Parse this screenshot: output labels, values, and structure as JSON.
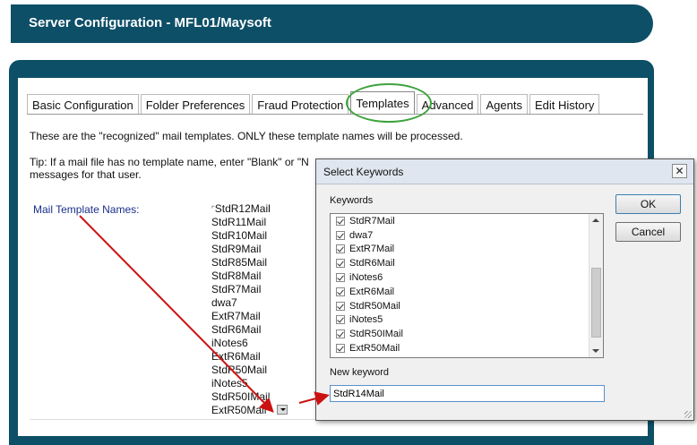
{
  "header": {
    "title": "Server Configuration - MFL01/Maysoft"
  },
  "tabs": [
    {
      "label": "Basic Configuration",
      "active": false
    },
    {
      "label": "Folder Preferences",
      "active": false
    },
    {
      "label": "Fraud Protection",
      "active": false
    },
    {
      "label": "Templates",
      "active": true
    },
    {
      "label": "Advanced",
      "active": false
    },
    {
      "label": "Agents",
      "active": false
    },
    {
      "label": "Edit History",
      "active": false
    }
  ],
  "content": {
    "intro": "These are the \"recognized\" mail templates. ONLY these template names will be processed.",
    "tip_line1": "Tip: If a mail file has no template name, enter \"Blank\" or \"N",
    "tip_line2": "messages for that user.",
    "field_label": "Mail Template Names:",
    "templates": [
      "StdR12Mail",
      "StdR11Mail",
      "StdR10Mail",
      "StdR9Mail",
      "StdR85Mail",
      "StdR8Mail",
      "StdR7Mail",
      "dwa7",
      "ExtR7Mail",
      "StdR6Mail",
      "iNotes6",
      "ExtR6Mail",
      "StdR50Mail",
      "iNotes5",
      "StdR50IMail",
      "ExtR50Mail"
    ]
  },
  "dialog": {
    "title": "Select Keywords",
    "close_label": "✕",
    "keywords_label": "Keywords",
    "keywords": [
      {
        "label": "StdR7Mail",
        "checked": true
      },
      {
        "label": "dwa7",
        "checked": true
      },
      {
        "label": "ExtR7Mail",
        "checked": true
      },
      {
        "label": "StdR6Mail",
        "checked": true
      },
      {
        "label": "iNotes6",
        "checked": true
      },
      {
        "label": "ExtR6Mail",
        "checked": true
      },
      {
        "label": "StdR50Mail",
        "checked": true
      },
      {
        "label": "iNotes5",
        "checked": true
      },
      {
        "label": "StdR50IMail",
        "checked": true
      },
      {
        "label": "ExtR50Mail",
        "checked": true
      }
    ],
    "new_keyword_label": "New keyword",
    "new_keyword_value": "StdR14Mail",
    "ok_label": "OK",
    "cancel_label": "Cancel"
  },
  "colors": {
    "header_bg": "#0d4f67",
    "highlight_ring": "#3ea33e",
    "annotation_arrow": "#cc1111",
    "label_blue": "#1a2f8a"
  }
}
